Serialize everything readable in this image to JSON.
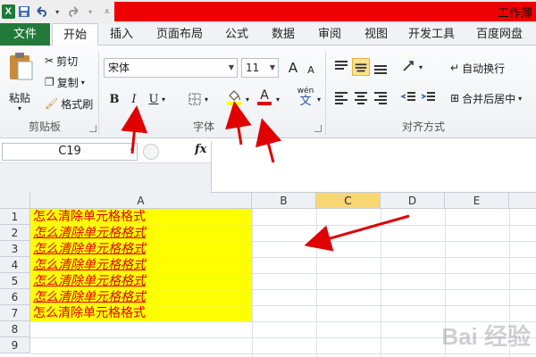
{
  "window": {
    "title": "工作薄"
  },
  "quick_access": {
    "logo": "X",
    "save_icon": "save-icon",
    "undo_icon": "undo-icon",
    "redo_icon": "redo-icon"
  },
  "tabs": [
    {
      "label": "文件",
      "kind": "file"
    },
    {
      "label": "开始",
      "kind": "active"
    },
    {
      "label": "插入"
    },
    {
      "label": "页面布局"
    },
    {
      "label": "公式"
    },
    {
      "label": "数据"
    },
    {
      "label": "审阅"
    },
    {
      "label": "视图"
    },
    {
      "label": "开发工具"
    },
    {
      "label": "百度网盘"
    }
  ],
  "clipboard": {
    "paste": "粘贴",
    "cut": "剪切",
    "copy": "复制",
    "format_painter": "格式刷",
    "group": "剪贴板"
  },
  "font": {
    "name": "宋体",
    "size": "11",
    "bold": "B",
    "italic": "I",
    "underline": "U",
    "font_color_glyph": "A",
    "wen": "wén",
    "wen_char": "文",
    "grow": "A",
    "shrink": "A",
    "group": "字体"
  },
  "alignment": {
    "wrap_text": "自动换行",
    "merge_center": "合并后居中",
    "group": "对齐方式"
  },
  "formula_bar": {
    "name_box": "C19",
    "fx": "fx",
    "value": ""
  },
  "sheet": {
    "columns": [
      "A",
      "B",
      "C",
      "D",
      "E"
    ],
    "selected_column": "C",
    "rows": [
      "1",
      "2",
      "3",
      "4",
      "5",
      "6",
      "7",
      "8",
      "9"
    ],
    "cells_a": [
      {
        "text": "怎么清除单元格格式",
        "format": "plain"
      },
      {
        "text": "怎么清除单元格格式",
        "format": "italic-underline"
      },
      {
        "text": "怎么清除单元格格式",
        "format": "italic-underline"
      },
      {
        "text": "怎么清除单元格格式",
        "format": "italic-underline"
      },
      {
        "text": "怎么清除单元格格式",
        "format": "italic-underline"
      },
      {
        "text": "怎么清除单元格格式",
        "format": "italic-underline"
      },
      {
        "text": "怎么清除单元格格式",
        "format": "plain"
      }
    ],
    "fill_color": "#ffff00",
    "text_color": "#e00000"
  },
  "watermark": "Bai 经验"
}
